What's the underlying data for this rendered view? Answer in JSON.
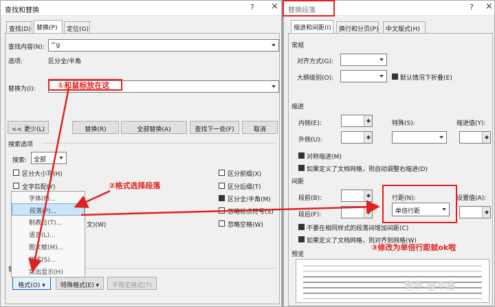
{
  "find_dialog": {
    "title": "查找和替换",
    "help": "?",
    "close": "×",
    "tabs": [
      "查找(D)",
      "替换(P)",
      "定位(G)"
    ],
    "find_label": "查找内容(N):",
    "find_value": "^g",
    "options_label": "选项:",
    "options_value": "区分全/半角",
    "replace_label": "替换为(I):",
    "buttons": {
      "less": "<< 更少(L)",
      "replace": "替换(R)",
      "replace_all": "全部替换(A)",
      "find_next": "查找下一处(F)",
      "cancel": "取消"
    },
    "search_options_heading": "搜索选项",
    "search_label": "搜索:",
    "search_value": "全部",
    "left_checks": [
      {
        "label": "区分大小写(H)",
        "checked": false
      },
      {
        "label": "全字匹配(Y)",
        "checked": false
      }
    ],
    "right_checks": [
      {
        "label": "区分前缀(X)",
        "checked": false
      },
      {
        "label": "区分后缀(T)",
        "checked": false
      },
      {
        "label": "区分全/半角(M)",
        "checked": true
      },
      {
        "label": "忽略标点符号(S)",
        "checked": false
      },
      {
        "label": "忽略空格(W)",
        "checked": false
      }
    ],
    "hidden_check_suffix": "文)(W)",
    "format_menu": [
      "字体(F)...",
      "段落(P)...",
      "制表位(T)...",
      "语言(L)...",
      "图文框(M)...",
      "样式(S)...",
      "突出显示(H)"
    ],
    "bottom_section_fragment": "替",
    "format_btn": "格式(O) ▾",
    "special_btn": "特殊格式(E) ▾",
    "no_format_btn": "不限定格式(T)"
  },
  "para_dialog": {
    "title": "替换段落",
    "help": "?",
    "close": "×",
    "tabs": [
      "缩进和间距(I)",
      "换行和分页(P)",
      "中文版式(H)"
    ],
    "general_heading": "常规",
    "alignment_label": "对齐方式(G):",
    "outline_label": "大纲级别(O):",
    "collapse_label": "默认情况下折叠(E)",
    "indent_heading": "缩进",
    "inside_label": "内侧(E):",
    "outside_label": "外侧(U):",
    "special_label": "特殊(S):",
    "indent_value_label": "缩进值(Y):",
    "mirror_label": "对称缩进(M)",
    "grid_adjust_label": "如果定义了文档网格，则自动调整右缩进(D)",
    "spacing_heading": "间距",
    "before_label": "段前(B):",
    "after_label": "段后(F):",
    "line_spacing_label": "行距(N):",
    "line_spacing_value": "单倍行距",
    "setting_label": "设置值(A):",
    "no_space_label": "不要在相同样式的段落间增加间距(C)",
    "snap_grid_label": "如果定义了文档网格，则对齐到网格(W)",
    "preview_heading": "预览"
  },
  "annotations": {
    "step1": "①和鼠标放在这",
    "step2": "②格式选择段落",
    "step3": "③修改为单倍行距就ok啦"
  },
  "watermark": "知乎 @不唐",
  "colors": {
    "annotation": "#e02020",
    "highlight": "#cce4f7"
  }
}
